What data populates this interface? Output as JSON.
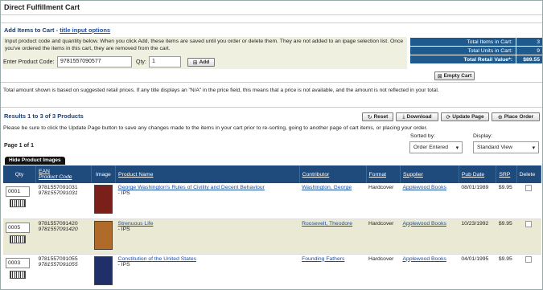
{
  "page": {
    "title": "Direct Fulfillment Cart"
  },
  "add": {
    "heading": "Add Items to Cart -",
    "options_link": "title input options",
    "instructions": "Input product code and quantity below. When you click Add, these items are saved until you order or delete them. They are not added to an ipage selection list. Once you've ordered the items in this cart, they are removed from the cart.",
    "product_code_label": "Enter Product Code:",
    "product_code_value": "9781557090577",
    "qty_label": "Qty:",
    "qty_value": "1",
    "add_button": "Add"
  },
  "totals": {
    "items_label": "Total Items in Cart:",
    "items_value": "3",
    "units_label": "Total Units in Cart:",
    "units_value": "9",
    "retail_label": "Total Retail Value*:",
    "retail_value": "$89.55",
    "empty_button": "Empty Cart"
  },
  "note": "Total amount shown is based on suggested retail prices. If any title displays an \"N/A\" in the price field, this means that a price is not available, and the amount is not reflected in your total.",
  "results": {
    "summary": "Results 1 to 3 of 3 Products",
    "buttons": {
      "reset": "Reset",
      "download": "Download",
      "update": "Update Page",
      "place": "Place Order"
    },
    "warning": "Please be sure to click the Update Page button to save any changes made to the items in your cart prior to re-sorting, going to another page of cart items, or placing your order.",
    "sort_label": "Sorted by:",
    "sort_value": "Order Entered",
    "display_label": "Display:",
    "display_value": "Standard View",
    "page_of": "Page 1 of 1",
    "hide_images": "Hide Product Images"
  },
  "table": {
    "headers": {
      "qty": "Qty",
      "ean": "EAN",
      "product_code": "Product Code",
      "image": "Image",
      "name": "Product Name",
      "contributor": "Contributor",
      "format": "Format",
      "supplier": "Supplier",
      "pub_date": "Pub Date",
      "srp": "SRP",
      "delete": "Delete"
    },
    "rows": [
      {
        "qty": "0001",
        "ean": "9781557091031",
        "code": "9781557091031",
        "name": "George Washington's Rules of Civility and Decent Behaviour",
        "sub": "- IPS",
        "contributor": "Washington, George",
        "format": "Hardcover",
        "supplier": "Applewood Books",
        "pub_date": "08/01/1989",
        "srp": "$9.95",
        "cover_color": "#7a1f1a"
      },
      {
        "qty": "0005",
        "ean": "9781557091420",
        "code": "9781557091420",
        "name": "Strenuous Life",
        "sub": "- IPS",
        "contributor": "Roosevelt, Theodore",
        "format": "Hardcover",
        "supplier": "Applewood Books",
        "pub_date": "10/23/1992",
        "srp": "$9.95",
        "cover_color": "#b06a2a"
      },
      {
        "qty": "0003",
        "ean": "9781557091055",
        "code": "9781557091055",
        "name": "Constitution of the United States",
        "sub": "- IPS",
        "contributor": "Founding Fathers",
        "format": "Hardcover",
        "supplier": "Applewood Books",
        "pub_date": "04/01/1995",
        "srp": "$9.95",
        "cover_color": "#1f2f6a"
      }
    ]
  }
}
